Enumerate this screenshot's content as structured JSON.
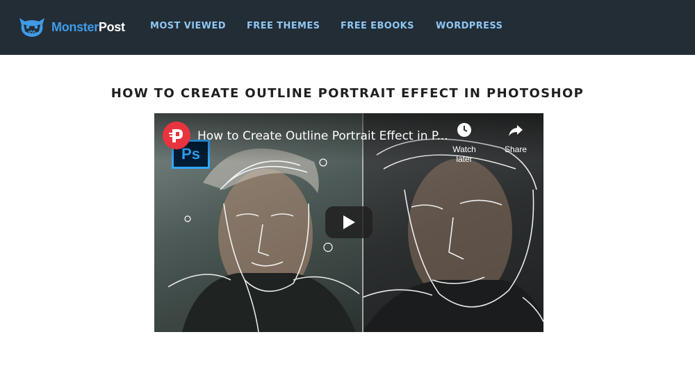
{
  "header": {
    "logo_part1": "Monster",
    "logo_part2": "Post",
    "nav": [
      {
        "label": "MOST VIEWED"
      },
      {
        "label": "FREE THEMES"
      },
      {
        "label": "FREE EBOOKS"
      },
      {
        "label": "WORDPRESS"
      }
    ]
  },
  "article": {
    "title": "HOW TO CREATE OUTLINE PORTRAIT EFFECT IN PHOTOSHOP"
  },
  "video": {
    "title": "How to Create Outline Portrait Effect in P...",
    "watch_later": "Watch later",
    "share": "Share",
    "ps_badge": "Ps",
    "icons": {
      "channel": "monsterpost-p-logo",
      "watch_later": "clock-icon",
      "share": "share-arrow-icon",
      "play": "play-icon"
    }
  },
  "colors": {
    "header_bg": "#232d36",
    "nav_text": "#8ec6f2",
    "logo_blue": "#3f9be8",
    "channel_red": "#e8343e"
  }
}
